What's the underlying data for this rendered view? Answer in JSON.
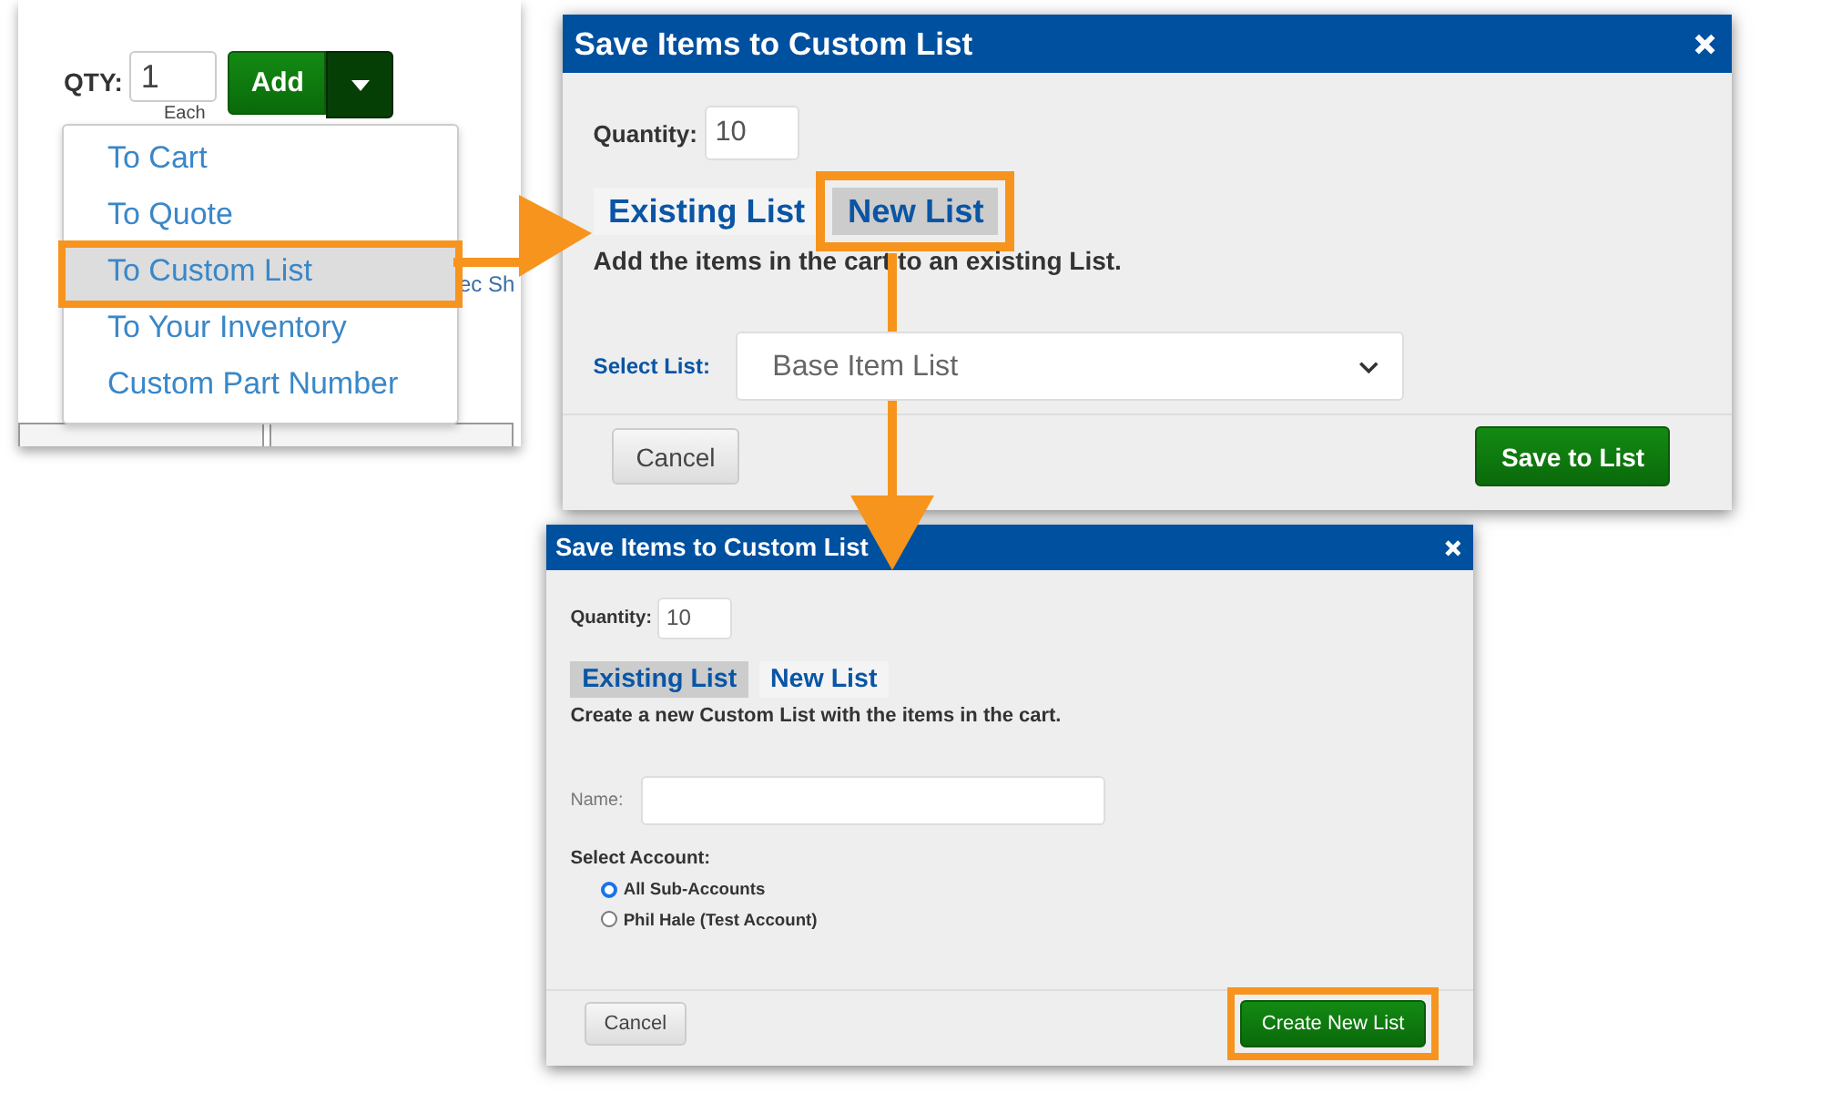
{
  "product_panel": {
    "qty_label": "QTY:",
    "qty_value": "1",
    "unit": "Each",
    "add_button": "Add",
    "behind_text": "ec Sh",
    "menu": [
      {
        "label": "To Cart",
        "selected": false,
        "callout": false
      },
      {
        "label": "To Quote",
        "selected": false,
        "callout": false
      },
      {
        "label": "To Custom List",
        "selected": true,
        "callout": true
      },
      {
        "label": "To Your Inventory",
        "selected": false,
        "callout": false
      },
      {
        "label": "Custom Part Number",
        "selected": false,
        "callout": false
      }
    ]
  },
  "dialogs": [
    {
      "title": "Save Items to Custom List",
      "quantity_label": "Quantity:",
      "quantity_value": "10",
      "tabs": [
        {
          "label": "Existing List",
          "selected": false,
          "callout": false
        },
        {
          "label": "New List",
          "selected": true,
          "callout": true
        }
      ],
      "description": "Add the items in the cart to an existing List.",
      "fields": [
        {
          "kind": "select",
          "label": "Select List:",
          "value": "Base Item List"
        }
      ],
      "cancel": "Cancel",
      "submit": {
        "label": "Save to List",
        "callout": false
      }
    },
    {
      "title": "Save Items to Custom List",
      "quantity_label": "Quantity:",
      "quantity_value": "10",
      "tabs": [
        {
          "label": "Existing List",
          "selected": true,
          "callout": false
        },
        {
          "label": "New List",
          "selected": false,
          "callout": false
        }
      ],
      "description": "Create a new Custom List with the items in the cart.",
      "fields": [
        {
          "kind": "text",
          "label": "Name:"
        },
        {
          "kind": "radio-group",
          "label": "Select Account:",
          "options": [
            {
              "label": "All Sub-Accounts",
              "selected": true
            },
            {
              "label": "Phil Hale (Test Account)",
              "selected": false
            }
          ]
        }
      ],
      "cancel": "Cancel",
      "submit": {
        "label": "Create New List",
        "callout": true
      }
    }
  ]
}
